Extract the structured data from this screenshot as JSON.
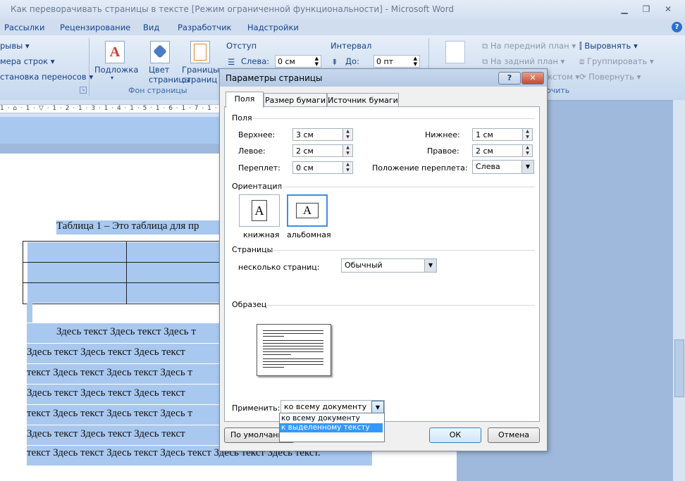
{
  "window": {
    "title": "Как переворачивать страницы в тексте [Режим ограниченной функциональности] - Microsoft Word"
  },
  "ribbon_tabs": [
    "Рассылки",
    "Рецензирование",
    "Вид",
    "Разработчик",
    "Надстройки"
  ],
  "ribbon": {
    "left_items": [
      "рывы",
      "мера строк",
      "становка переносов"
    ],
    "page_bg": {
      "buttons": [
        "Подложка",
        "Цвет страницы",
        "Границы страниц"
      ],
      "group_label": "Фон страницы"
    },
    "indent": {
      "label": "Отступ",
      "left_label": "Слева:",
      "left_value": "0 см"
    },
    "spacing": {
      "label": "Интервал",
      "before_label": "До:",
      "before_value": "0 пт"
    },
    "arrange": {
      "forward": "На передний план",
      "backward": "На задний план",
      "wrap": "екстом",
      "align": "Выровнять",
      "group": "Группировать",
      "rotate": "Повернуть",
      "group_label": "очить"
    }
  },
  "document": {
    "caption": "Таблица 1 – Это таблица для пр",
    "lines": [
      "Здесь текст Здесь текст Здесь т",
      "Здесь текст Здесь текст Здесь текст",
      "текст Здесь текст Здесь текст Здесь т",
      "Здесь текст Здесь текст Здесь текст",
      "текст Здесь текст Здесь текст Здесь т",
      "Здесь текст Здесь текст Здесь текст",
      "текст Здесь текст Здесь текст Здесь текст Здесь текст Здесь текст."
    ]
  },
  "dialog": {
    "title": "Параметры страницы",
    "tabs": [
      "Поля",
      "Размер бумаги",
      "Источник бумаги"
    ],
    "margins_section": "Поля",
    "top_label": "Верхнее:",
    "top_value": "3 см",
    "bottom_label": "Нижнее:",
    "bottom_value": "1 см",
    "left_label": "Левое:",
    "left_value": "2 см",
    "right_label": "Правое:",
    "right_value": "2 см",
    "gutter_label": "Переплет:",
    "gutter_value": "0 см",
    "gutter_pos_label": "Положение переплета:",
    "gutter_pos_value": "Слева",
    "orientation_section": "Ориентация",
    "portrait": "книжная",
    "landscape": "альбомная",
    "pages_section": "Страницы",
    "multiple_label": "несколько страниц:",
    "multiple_value": "Обычный",
    "preview_section": "Образец",
    "apply_label": "Применить:",
    "apply_value": "ко всему документу",
    "apply_options": [
      "ко всему документу",
      "к выделенному тексту"
    ],
    "default_btn": "По умолчанию",
    "ok_btn": "ОК",
    "cancel_btn": "Отмена",
    "help_btn": "?",
    "close_btn": "✕"
  }
}
